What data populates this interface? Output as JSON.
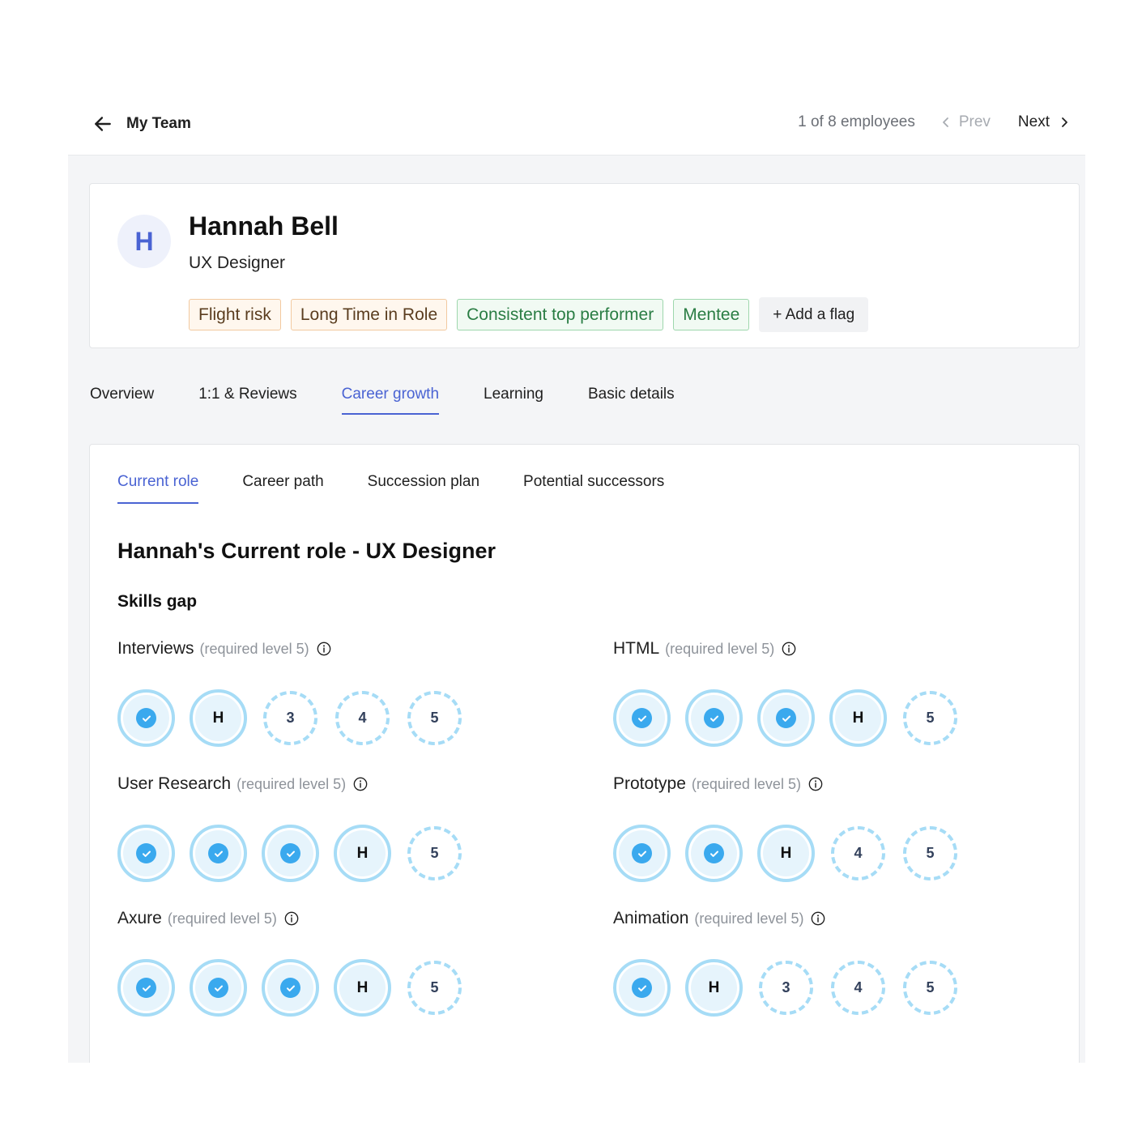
{
  "header": {
    "back_label": "My Team",
    "pager_count": "1 of 8 employees",
    "prev_label": "Prev",
    "next_label": "Next"
  },
  "profile": {
    "initial": "H",
    "name": "Hannah Bell",
    "role": "UX Designer",
    "flags": [
      {
        "label": "Flight risk",
        "color": "#f2c9a0"
      },
      {
        "label": "Long Time in Role",
        "color": "#f2c9a0"
      },
      {
        "label": "Consistent top performer",
        "color": "#9ed7ad"
      },
      {
        "label": "Mentee",
        "color": "#9ed7ad"
      }
    ],
    "add_flag_label": "+ Add a flag"
  },
  "main_tabs": [
    "Overview",
    "1:1 & Reviews",
    "Career growth",
    "Learning",
    "Basic details"
  ],
  "main_tab_active": "Career growth",
  "sub_tabs": [
    "Current role",
    "Career path",
    "Succession plan",
    "Potential successors"
  ],
  "sub_tab_active": "Current role",
  "section_title": "Hannah's Current role - UX Designer",
  "skills_gap_title": "Skills gap",
  "accent_color": "#4a63d3",
  "skills": [
    {
      "name": "Interviews",
      "requirement": "(required level 5)",
      "current_level": 2,
      "levels": [
        "done",
        "H",
        "3",
        "4",
        "5"
      ]
    },
    {
      "name": "HTML",
      "requirement": "(required level 5)",
      "current_level": 4,
      "levels": [
        "done",
        "done",
        "done",
        "H",
        "5"
      ]
    },
    {
      "name": "User Research",
      "requirement": "(required level 5)",
      "current_level": 4,
      "levels": [
        "done",
        "done",
        "done",
        "H",
        "5"
      ]
    },
    {
      "name": "Prototype",
      "requirement": "(required level 5)",
      "current_level": 3,
      "levels": [
        "done",
        "done",
        "H",
        "4",
        "5"
      ]
    },
    {
      "name": "Axure",
      "requirement": "(required level 5)",
      "current_level": 4,
      "levels": [
        "done",
        "done",
        "done",
        "H",
        "5"
      ]
    },
    {
      "name": "Animation",
      "requirement": "(required level 5)",
      "current_level": 2,
      "levels": [
        "done",
        "H",
        "3",
        "4",
        "5"
      ]
    }
  ]
}
